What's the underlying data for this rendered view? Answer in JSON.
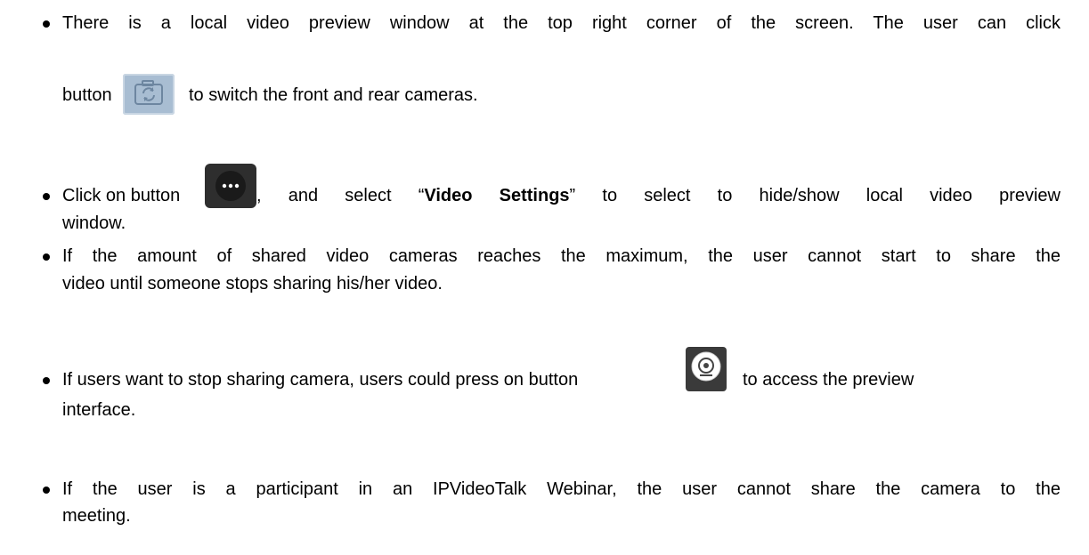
{
  "bullets": [
    {
      "line1": "There is a local video preview window at the top right corner of the screen. The user can click",
      "line2_pre": "button",
      "line2_post": "to switch the front and rear cameras.",
      "icon": "camera-switch-icon"
    },
    {
      "line1_pre": "Click on button",
      "line1_mid1": ", and select “",
      "line1_bold": "Video Settings",
      "line1_post": "” to select to hide/show local video preview",
      "line2": "window.",
      "icon": "more-options-icon"
    },
    {
      "line1": "If the amount of shared video cameras reaches the maximum, the user cannot start to share the",
      "line2": "video until someone stops sharing his/her video."
    },
    {
      "line1_pre": "If users want to stop sharing camera, users could press on button",
      "line1_post": "to access the preview",
      "line2": "interface.",
      "icon": "stop-camera-icon"
    },
    {
      "line1": "If the user is a participant in an IPVideoTalk Webinar, the user cannot share the camera to the",
      "line2": "meeting."
    }
  ],
  "colors": {
    "text": "#000000",
    "camera_switch_bg": "#a8bdd2",
    "more_bg": "#2e2e2e",
    "stop_camera_bg": "#3a3a3a"
  }
}
